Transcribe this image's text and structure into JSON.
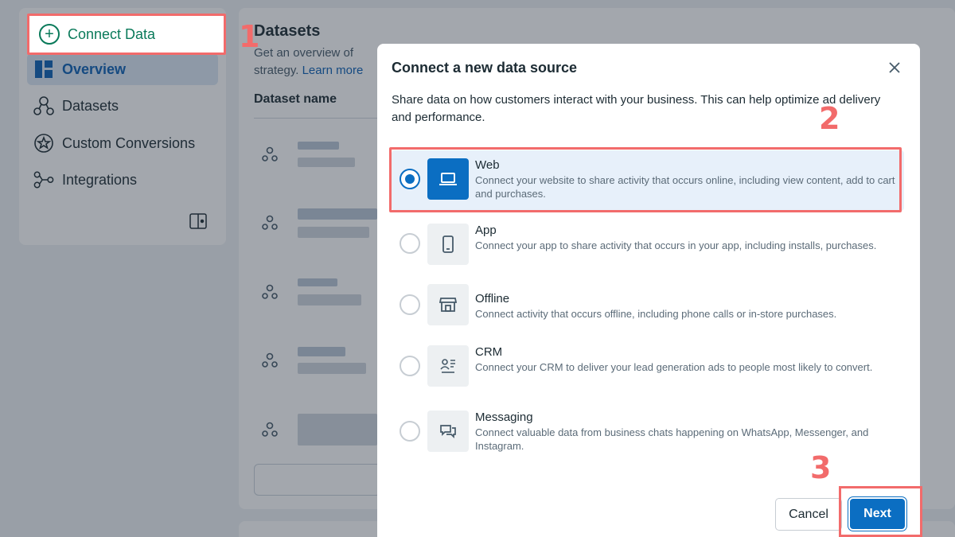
{
  "sidebar": {
    "connect_data": "Connect Data",
    "items": [
      {
        "label": "Overview",
        "icon": "overview-icon",
        "active": true
      },
      {
        "label": "Datasets",
        "icon": "datasets-icon",
        "active": false
      },
      {
        "label": "Custom Conversions",
        "icon": "custom-conversions-icon",
        "active": false
      },
      {
        "label": "Integrations",
        "icon": "integrations-icon",
        "active": false
      }
    ]
  },
  "main": {
    "title": "Datasets",
    "subtitle_line1": "Get an overview of",
    "subtitle_line2": "strategy.",
    "learn_more": "Learn more",
    "column_header": "Dataset name"
  },
  "modal": {
    "title": "Connect a new data source",
    "description": "Share data on how customers interact with your business. This can help optimize ad delivery and performance.",
    "options": [
      {
        "name": "Web",
        "description": "Connect your website to share activity that occurs online, including view content, add to cart and purchases.",
        "icon": "laptop-icon",
        "selected": true
      },
      {
        "name": "App",
        "description": "Connect your app to share activity that occurs in your app, including installs, purchases.",
        "icon": "phone-icon",
        "selected": false
      },
      {
        "name": "Offline",
        "description": "Connect activity that occurs offline, including phone calls or in-store purchases.",
        "icon": "storefront-icon",
        "selected": false
      },
      {
        "name": "CRM",
        "description": "Connect your CRM to deliver your lead generation ads to people most likely to convert.",
        "icon": "crm-icon",
        "selected": false
      },
      {
        "name": "Messaging",
        "description": "Connect valuable data from business chats happening on WhatsApp, Messenger, and Instagram.",
        "icon": "chat-icon",
        "selected": false
      }
    ],
    "cancel_label": "Cancel",
    "next_label": "Next"
  },
  "annotations": {
    "step1": "1",
    "step2": "2",
    "step3": "3"
  },
  "colors": {
    "accent": "#0b6ec2",
    "highlight": "#f26b6b",
    "connect_green": "#0a7a5a"
  }
}
